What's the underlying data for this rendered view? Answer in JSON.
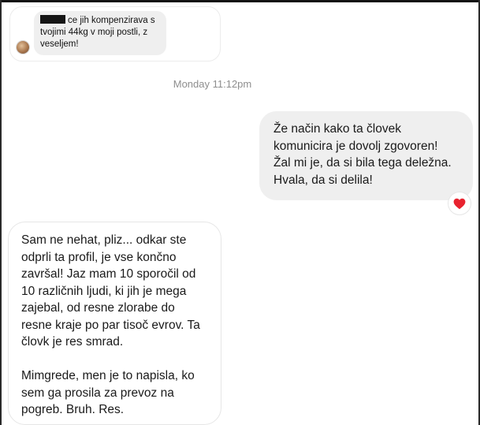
{
  "quoted_message": {
    "text": "ce jih kompenzirava s tvojimi 44kg v moji postli, z veseljem!"
  },
  "timestamp": "Monday 11:12pm",
  "outgoing_message": {
    "text": "Že način kako ta človek\nkomunicira je dovolj zgovoren!\nŽal mi je, da si bila tega deležna.\nHvala, da si delila!",
    "reaction": "heart-icon",
    "reaction_color": "#e8232f"
  },
  "incoming_message": {
    "paragraph1": "Sam ne nehat, pliz... odkar ste\nodprli ta profil, je vse končno\nzavršal! Jaz mam 10 sporočil od\n10 različnih ljudi, ki jih je mega\nzajebal, od resne zlorabe do\nresne kraje po par tisoč evrov. Ta\nčlovk je res smrad.",
    "paragraph2": "Mimgrede, men je to napisla, ko\nsem ga prosila za prevoz na\npogreb. Bruh. Res."
  },
  "colors": {
    "outgoing_bubble": "#efefef",
    "incoming_bubble": "#ffffff",
    "timestamp": "#8e8e8e"
  }
}
